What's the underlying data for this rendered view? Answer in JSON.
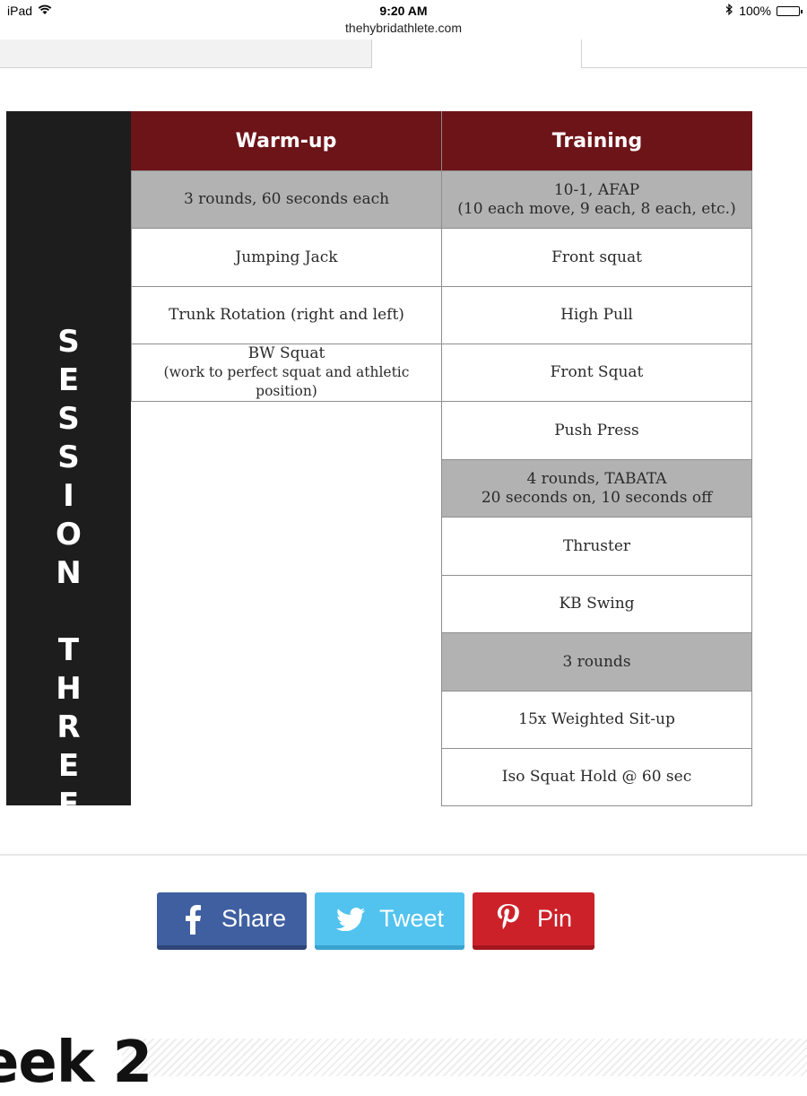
{
  "status_bar": {
    "device": "iPad",
    "time": "9:20 AM",
    "battery": "100%",
    "battery_level": 1.0
  },
  "browser": {
    "url": "thehybridathlete.com"
  },
  "session": {
    "letters_line1": [
      "S",
      "E",
      "S",
      "S",
      "I",
      "O",
      "N"
    ],
    "letters_line2": [
      "T",
      "H",
      "R",
      "E",
      "E"
    ]
  },
  "table": {
    "headers": {
      "warmup": "Warm-up",
      "training": "Training"
    },
    "warmup": [
      {
        "text": "3 rounds, 60 seconds each",
        "grey": true
      },
      {
        "text": "Jumping Jack"
      },
      {
        "text": "Trunk Rotation (right and left)"
      },
      {
        "line1": "BW Squat",
        "line2": "(work to perfect squat and athletic position)"
      }
    ],
    "training": [
      {
        "line1": "10-1, AFAP",
        "line2": "(10 each move, 9 each, 8 each, etc.)",
        "grey": true
      },
      {
        "text": "Front squat"
      },
      {
        "text": "High Pull"
      },
      {
        "text": "Front Squat"
      },
      {
        "text": "Push Press"
      },
      {
        "line1": "4 rounds, TABATA",
        "line2": "20 seconds on, 10 seconds off",
        "grey": true
      },
      {
        "text": "Thruster"
      },
      {
        "text": "KB Swing"
      },
      {
        "text": "3 rounds",
        "grey": true
      },
      {
        "text": "15x Weighted Sit-up"
      },
      {
        "text": "Iso Squat Hold @ 60 sec"
      }
    ]
  },
  "share": {
    "facebook_label": "Share",
    "twitter_label": "Tweet",
    "pinterest_label": "Pin",
    "colors": {
      "facebook": "#3f5fa0",
      "twitter": "#52c3ef",
      "pinterest": "#cc2129"
    }
  },
  "next_heading": "eek 2",
  "colors": {
    "header": "#6d1419",
    "session_bar": "#1d1d1d",
    "grey_row": "#b2b2b2"
  }
}
